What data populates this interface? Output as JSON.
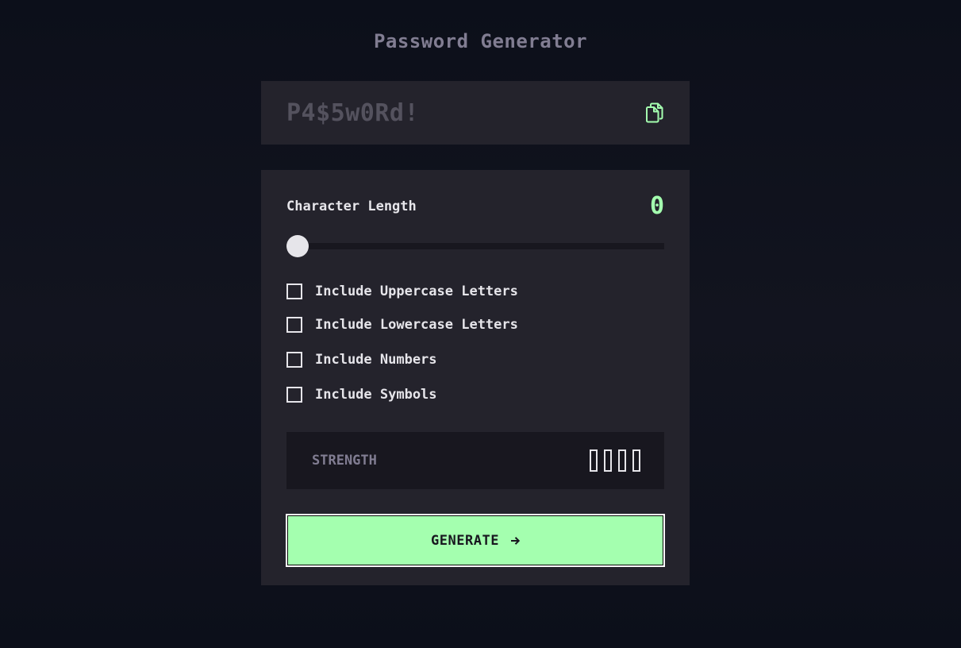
{
  "app": {
    "title": "Password Generator"
  },
  "display": {
    "password": "P4$5w0Rd!",
    "copy_icon": "copy-icon"
  },
  "length": {
    "label": "Character Length",
    "value": "0",
    "slider_fraction": 0
  },
  "options": [
    {
      "label": "Include Uppercase Letters",
      "checked": false
    },
    {
      "label": "Include Lowercase Letters",
      "checked": false
    },
    {
      "label": "Include Numbers",
      "checked": false
    },
    {
      "label": "Include Symbols",
      "checked": false
    }
  ],
  "strength": {
    "label": "STRENGTH",
    "bars_filled": 0,
    "bars_total": 4
  },
  "generate": {
    "label": "GENERATE",
    "icon": "arrow-right-icon"
  },
  "colors": {
    "accent": "#a4ffaf",
    "panel": "#24232c",
    "dark": "#18171f",
    "muted": "#817d92"
  }
}
